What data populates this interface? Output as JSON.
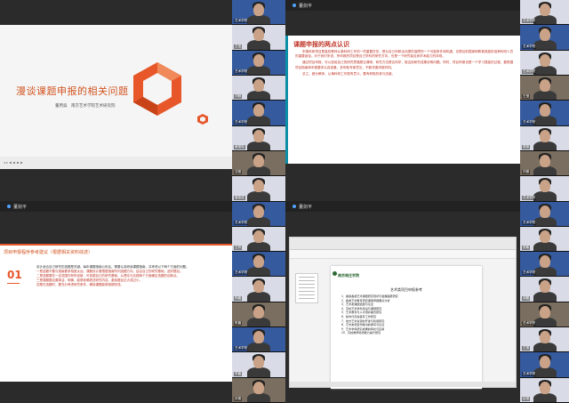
{
  "quadrants": {
    "top_left": {
      "slide": {
        "title": "漫谈课题申报的相关问题",
        "author": "董用淼　南京艺术学院艺术研究院"
      }
    },
    "top_right": {
      "bar_label": "董剑平",
      "slide": {
        "title": "课题申报的两点认识",
        "paragraphs": [
          "申报科研项目是高校教师从事科研工作的一项重要任务，是为自己科研活动提供保障的一个可能条件和机遇，也是目前国家和教育部高校培养科研人员的重要途径。对于我们来说，所申报的项目是自己学科的研究方向，也是一个研究者自身学术能力的体现。",
          "通过项目申报，可以检验自己的研究思路是否清晰，研究方法是否科学，能否用研究成果说明问题。同时，项目申报也是一个学习提高的过程，要根据项目指南和申报要求认真准备，多听取专家意见，不断完善申报材料。",
          "总之，做为教师，从事科研工作很有意义，要有积极的参与态度。"
        ]
      }
    },
    "bottom_left": {
      "bar_label": "董剑平",
      "slide": {
        "title": "项目申报程序参考建议（根据相关资料综述）",
        "number": "01",
        "paragraphs": [
          "设计适合自己研究的选题是关键。每年课题指南公布后，需要认真研读课题指南，并考虑以下两个方面的问题。",
          "一是选题不要与指南要求相差太远。课题设计要根据指南所列选题方向，结合自己的研究基础，选好题目。",
          "二是选题要在一定范围内有所创新。可依据自己的研究基础，从理论与实践两个方面确定选题的创新点。",
          "三是课题题目要简洁、明确，能够准确表述研究内容，避免题目过大或过小。",
          "四是在选题时，要充分考虑研究条件，确保课题能够按期完成。"
        ]
      }
    },
    "bottom_right": {
      "bar_label": "董剑平",
      "doc": {
        "school": "南京晓庄学院",
        "title": "艺术类项目申报参考",
        "items": [
          "1．各级各类艺术课题研究现状与发展趋势研究",
          "2．各类艺术教育研究课题申报要点分析",
          "3．艺术类课题选题与论证",
          "4．高校艺术学科建设与课题研究",
          "5．艺术教育与人才培养模式研究",
          "6．新时代高校美育工作研究",
          "7．地方艺术资源的开发与利用研究",
          "8．艺术类项目申报书的撰写与论证",
          "9．艺术学科研究成果的转化与应用",
          "10．高校教师科研能力提升研究"
        ]
      }
    }
  },
  "participants_left": [
    {
      "name": "艺术学院",
      "style": "blue"
    },
    {
      "name": "王莹",
      "style": "light"
    },
    {
      "name": "艺术学院",
      "style": "blue"
    },
    {
      "name": "刘畅",
      "style": "light"
    },
    {
      "name": "艺术学院",
      "style": "blue"
    },
    {
      "name": "黄丽丽",
      "style": "light"
    },
    {
      "name": "沈丽",
      "style": "room"
    },
    {
      "name": "曾俊斌",
      "style": "light"
    },
    {
      "name": "艺术学院",
      "style": "blue"
    },
    {
      "name": "王梓",
      "style": "light"
    },
    {
      "name": "艺术学院",
      "style": "blue"
    },
    {
      "name": "杨晨",
      "style": "light"
    },
    {
      "name": "陈晨",
      "style": "room"
    },
    {
      "name": "艺术学院",
      "style": "blue"
    },
    {
      "name": "李晨",
      "style": "light"
    },
    {
      "name": "孙丽",
      "style": "room"
    }
  ],
  "participants_right": [
    {
      "name": "艺术学院",
      "style": "light"
    },
    {
      "name": "艺术学院",
      "style": "blue"
    },
    {
      "name": "艺术学院",
      "style": "light"
    },
    {
      "name": "王莹",
      "style": "room"
    },
    {
      "name": "艺术学院",
      "style": "blue"
    },
    {
      "name": "周丽",
      "style": "light"
    },
    {
      "name": "刘丽",
      "style": "room"
    },
    {
      "name": "艺术学院",
      "style": "light"
    },
    {
      "name": "艺术学院",
      "style": "blue"
    },
    {
      "name": "张敏",
      "style": "light"
    },
    {
      "name": "艺术学院",
      "style": "blue"
    },
    {
      "name": "胡晨",
      "style": "light"
    },
    {
      "name": "艺术学院",
      "style": "room"
    },
    {
      "name": "王丽",
      "style": "light"
    },
    {
      "name": "艺术学院",
      "style": "blue"
    },
    {
      "name": "赵丽",
      "style": "light"
    }
  ]
}
